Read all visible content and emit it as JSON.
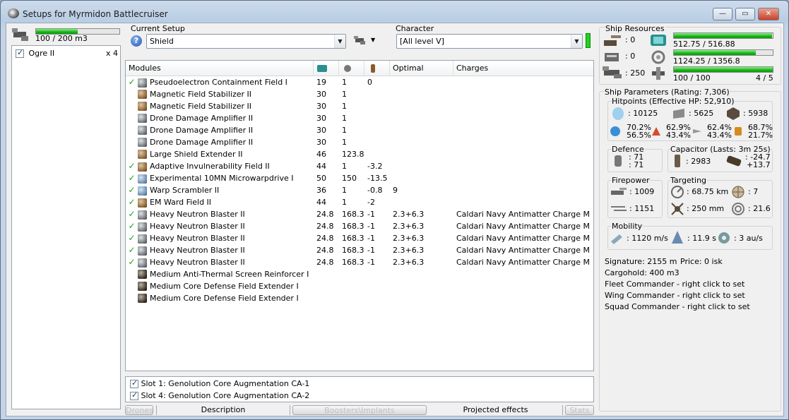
{
  "window": {
    "title": "Setups for Myrmidon Battlecruiser",
    "minimize": "—",
    "maximize": "▭",
    "close": "✕"
  },
  "drones": {
    "bandwidth": "100 / 200 m3",
    "bandwidth_pct": 50,
    "items": [
      {
        "name": "Ogre II",
        "count": "x 4",
        "checked": true
      }
    ]
  },
  "setup": {
    "label": "Current Setup",
    "value": "Shield",
    "help": "?"
  },
  "character": {
    "label": "Character",
    "value": "[All level V]"
  },
  "modules": {
    "headers": {
      "name": "Modules",
      "optimal": "Optimal",
      "charges": "Charges"
    },
    "rows": [
      {
        "online": true,
        "icon": "grey",
        "name": "Pseudoelectron Containment Field I",
        "cpu": "19",
        "pg": "1",
        "cap": "0",
        "optimal": "",
        "charge": ""
      },
      {
        "online": false,
        "icon": "brown",
        "name": "Magnetic Field Stabilizer II",
        "cpu": "30",
        "pg": "1",
        "cap": "",
        "optimal": "",
        "charge": ""
      },
      {
        "online": false,
        "icon": "brown",
        "name": "Magnetic Field Stabilizer II",
        "cpu": "30",
        "pg": "1",
        "cap": "",
        "optimal": "",
        "charge": ""
      },
      {
        "online": false,
        "icon": "grey",
        "name": "Drone Damage Amplifier II",
        "cpu": "30",
        "pg": "1",
        "cap": "",
        "optimal": "",
        "charge": ""
      },
      {
        "online": false,
        "icon": "grey",
        "name": "Drone Damage Amplifier II",
        "cpu": "30",
        "pg": "1",
        "cap": "",
        "optimal": "",
        "charge": ""
      },
      {
        "online": false,
        "icon": "grey",
        "name": "Drone Damage Amplifier II",
        "cpu": "30",
        "pg": "1",
        "cap": "",
        "optimal": "",
        "charge": ""
      },
      {
        "online": false,
        "icon": "brown",
        "name": "Large Shield Extender II",
        "cpu": "46",
        "pg": "123.8",
        "cap": "",
        "optimal": "",
        "charge": ""
      },
      {
        "online": true,
        "icon": "brown",
        "name": "Adaptive Invulnerability Field II",
        "cpu": "44",
        "pg": "1",
        "cap": "-3.2",
        "optimal": "",
        "charge": ""
      },
      {
        "online": true,
        "icon": "blue",
        "name": "Experimental 10MN Microwarpdrive I",
        "cpu": "50",
        "pg": "150",
        "cap": "-13.5",
        "optimal": "",
        "charge": ""
      },
      {
        "online": true,
        "icon": "blue",
        "name": "Warp Scrambler II",
        "cpu": "36",
        "pg": "1",
        "cap": "-0.8",
        "optimal": "9",
        "charge": ""
      },
      {
        "online": true,
        "icon": "brown",
        "name": "EM Ward Field II",
        "cpu": "44",
        "pg": "1",
        "cap": "-2",
        "optimal": "",
        "charge": ""
      },
      {
        "online": true,
        "icon": "grey",
        "name": "Heavy Neutron Blaster II",
        "cpu": "24.8",
        "pg": "168.3",
        "cap": "-1",
        "optimal": "2.3+6.3",
        "charge": "Caldari Navy Antimatter Charge M"
      },
      {
        "online": true,
        "icon": "grey",
        "name": "Heavy Neutron Blaster II",
        "cpu": "24.8",
        "pg": "168.3",
        "cap": "-1",
        "optimal": "2.3+6.3",
        "charge": "Caldari Navy Antimatter Charge M"
      },
      {
        "online": true,
        "icon": "grey",
        "name": "Heavy Neutron Blaster II",
        "cpu": "24.8",
        "pg": "168.3",
        "cap": "-1",
        "optimal": "2.3+6.3",
        "charge": "Caldari Navy Antimatter Charge M"
      },
      {
        "online": true,
        "icon": "grey",
        "name": "Heavy Neutron Blaster II",
        "cpu": "24.8",
        "pg": "168.3",
        "cap": "-1",
        "optimal": "2.3+6.3",
        "charge": "Caldari Navy Antimatter Charge M"
      },
      {
        "online": true,
        "icon": "grey",
        "name": "Heavy Neutron Blaster II",
        "cpu": "24.8",
        "pg": "168.3",
        "cap": "-1",
        "optimal": "2.3+6.3",
        "charge": "Caldari Navy Antimatter Charge M"
      },
      {
        "online": false,
        "icon": "dark",
        "name": "Medium Anti-Thermal Screen Reinforcer I",
        "cpu": "",
        "pg": "",
        "cap": "",
        "optimal": "",
        "charge": ""
      },
      {
        "online": false,
        "icon": "dark",
        "name": "Medium Core Defense Field Extender I",
        "cpu": "",
        "pg": "",
        "cap": "",
        "optimal": "",
        "charge": ""
      },
      {
        "online": false,
        "icon": "dark",
        "name": "Medium Core Defense Field Extender I",
        "cpu": "",
        "pg": "",
        "cap": "",
        "optimal": "",
        "charge": ""
      }
    ]
  },
  "implants": [
    {
      "label": "Slot 1: Genolution Core Augmentation CA-1",
      "checked": true
    },
    {
      "label": "Slot 4: Genolution Core Augmentation CA-2",
      "checked": true
    }
  ],
  "tabs": {
    "drones": "Drones",
    "description": "Description",
    "boosters": "Boosters\\Implants",
    "projected": "Projected effects",
    "stats": "Stats"
  },
  "resources": {
    "label": "Ship Resources",
    "hardpoints": [
      ": 0",
      ": 0",
      ": 250"
    ],
    "cpu": {
      "text": "512.75 / 516.88",
      "pct": 99.2
    },
    "powergrid": {
      "text": "1124.25 / 1356.8",
      "pct": 82.9
    },
    "calibration": {
      "text": "100 / 100",
      "pct": 100,
      "rigs": "4 / 5"
    }
  },
  "params": {
    "label": "Ship Parameters (Rating: 7,306)",
    "hitpoints": {
      "label": "Hitpoints (Effective HP: 52,910)",
      "shield": ": 10125",
      "armor": ": 5625",
      "hull": ": 5938",
      "res": [
        {
          "a": "70.2%",
          "b": "56.5%"
        },
        {
          "a": "62.9%",
          "b": "43.4%"
        },
        {
          "a": "62.4%",
          "b": "43.4%"
        },
        {
          "a": "68.7%",
          "b": "21.7%"
        }
      ]
    },
    "defence": {
      "label": "Defence",
      "a": ": 71",
      "b": ": 71"
    },
    "capacitor": {
      "label": "Capacitor (Lasts: 3m 25s)",
      "cap": ": 2983",
      "delta1": ": -24.7",
      "delta2": "+13.7"
    },
    "firepower": {
      "label": "Firepower",
      "dps": ": 1009",
      "volley": ": 1151"
    },
    "targeting": {
      "label": "Targeting",
      "range": ": 68.75 km",
      "targets": ": 7",
      "scan": ": 250 mm",
      "sensor": ": 21.6"
    },
    "mobility": {
      "label": "Mobility",
      "speed": ": 1120 m/s",
      "align": ": 11.9 s",
      "warp": ": 3 au/s"
    },
    "signature": "Signature: 2155 m",
    "price": "Price: 0 isk",
    "cargo": "Cargohold: 400 m3",
    "fleet": "Fleet Commander - right click to set",
    "wing": "Wing Commander - right click to set",
    "squad": "Squad Commander - right click to set"
  }
}
